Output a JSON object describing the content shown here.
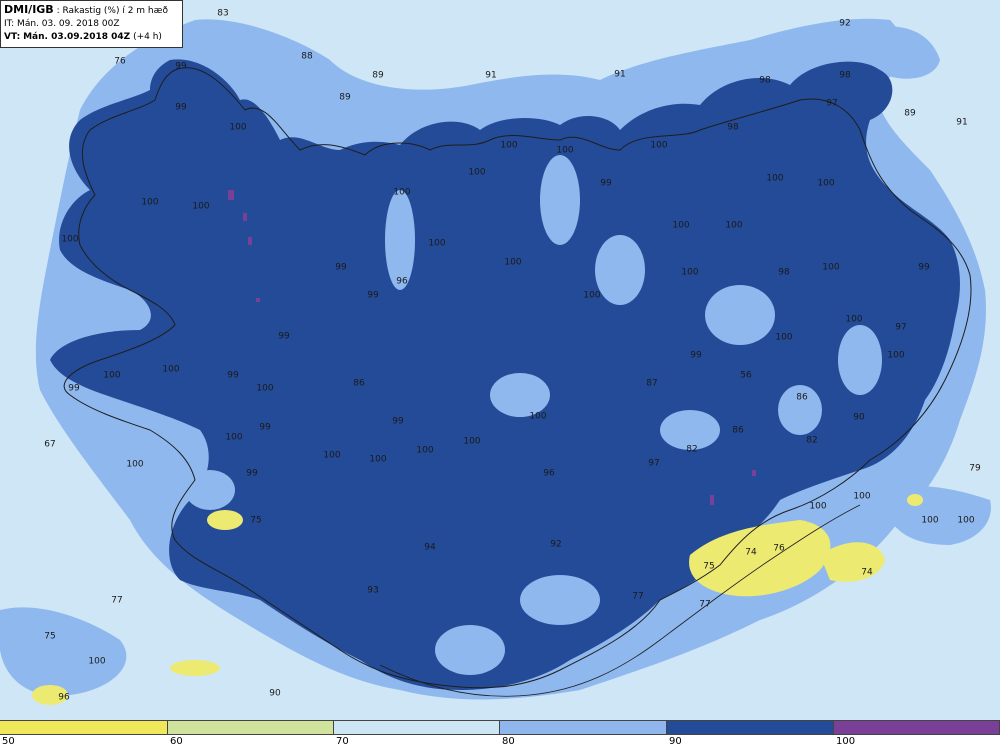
{
  "header": {
    "product": "DMI/IGB",
    "parameter": ": Rakastig (%) í 2 m hæð",
    "init_time": "IT: Mán. 03. 09. 2018 00Z",
    "valid_prefix": "VT:",
    "valid_time": "Mán. 03.09.2018 04Z",
    "lead": "(+4 h)"
  },
  "legend": {
    "colors": [
      "#f0e85a",
      "#cfe39c",
      "#cde6f5",
      "#8fb7ee",
      "#244b97",
      "#7a3f96"
    ],
    "ticks": [
      "50",
      "60",
      "70",
      "80",
      "90",
      "100"
    ]
  },
  "map_colors": {
    "sea_light": "#cfe6f6",
    "mid_blue": "#8fb8ee",
    "dark_blue": "#244b97",
    "purple": "#7a3f96",
    "yellow": "#edea72",
    "coast": "#1e1e1e"
  },
  "values": [
    "83",
    "88",
    "89",
    "89",
    "76",
    "99",
    "99",
    "100",
    "91",
    "91",
    "92",
    "98",
    "98",
    "97",
    "89",
    "91",
    "98",
    "100",
    "100",
    "100",
    "100",
    "100",
    "100",
    "100",
    "99",
    "100",
    "100",
    "100",
    "100",
    "100",
    "100",
    "98",
    "100",
    "99",
    "100",
    "100",
    "99",
    "96",
    "99",
    "100",
    "100",
    "100",
    "97",
    "99",
    "100",
    "99",
    "99",
    "100",
    "100",
    "99",
    "100",
    "86",
    "87",
    "99",
    "100",
    "100",
    "100",
    "100",
    "100",
    "99",
    "100",
    "99",
    "96",
    "97",
    "82",
    "86",
    "86",
    "90",
    "82",
    "56",
    "67",
    "100",
    "79",
    "100",
    "100",
    "100",
    "100",
    "76",
    "74",
    "75",
    "74",
    "75",
    "94",
    "92",
    "93",
    "77",
    "75",
    "100",
    "96",
    "90",
    "77",
    "77"
  ]
}
